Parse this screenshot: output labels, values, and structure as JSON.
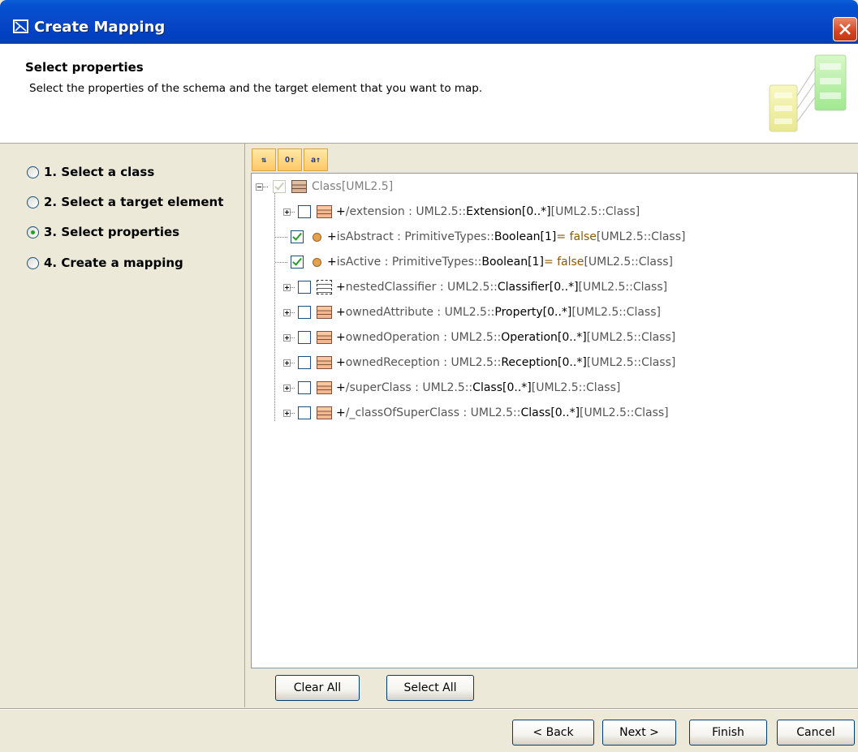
{
  "window": {
    "title": "Create Mapping",
    "close_icon": "close-icon"
  },
  "header": {
    "title": "Select properties",
    "description": "Select the properties of the schema and the target element that you want to map."
  },
  "steps": [
    {
      "label": "1. Select a class",
      "selected": false
    },
    {
      "label": "2. Select a target element",
      "selected": false
    },
    {
      "label": "3. Select properties",
      "selected": true
    },
    {
      "label": "4. Create a mapping",
      "selected": false
    }
  ],
  "toolbar": [
    {
      "icon": "sort-icon",
      "glyph": "⇅"
    },
    {
      "icon": "show-operations-icon",
      "glyph": "O↑"
    },
    {
      "icon": "show-inherited-icon",
      "glyph": "a↑"
    }
  ],
  "tree": {
    "root": {
      "label": "Class",
      "suffix": " [UML2.5]",
      "checked": true,
      "disabled": true
    },
    "items": [
      {
        "name": "/extension",
        "type_prefix": "UML2.5::",
        "type_name": "Extension",
        "mult": " [0..*]",
        "default": "",
        "owner": " [UML2.5::Class]",
        "checked": false,
        "icon": "class-icon",
        "expandable": true
      },
      {
        "name": "isAbstract",
        "type_prefix": "PrimitiveTypes::",
        "type_name": "Boolean",
        "mult": " [1]",
        "default": " = false",
        "owner": " [UML2.5::Class]",
        "checked": true,
        "icon": "property-dot-icon",
        "expandable": false
      },
      {
        "name": "isActive",
        "type_prefix": "PrimitiveTypes::",
        "type_name": "Boolean",
        "mult": " [1]",
        "default": " = false",
        "owner": " [UML2.5::Class]",
        "checked": true,
        "icon": "property-dot-icon",
        "expandable": false
      },
      {
        "name": "nestedClassifier",
        "type_prefix": "UML2.5::",
        "type_name": "Classifier",
        "mult": " [0..*]",
        "default": "",
        "owner": " [UML2.5::Class]",
        "checked": false,
        "icon": "classifier-icon",
        "expandable": true
      },
      {
        "name": "ownedAttribute",
        "type_prefix": "UML2.5::",
        "type_name": "Property",
        "mult": " [0..*]",
        "default": "",
        "owner": " [UML2.5::Class]",
        "checked": false,
        "icon": "class-icon",
        "expandable": true
      },
      {
        "name": "ownedOperation",
        "type_prefix": "UML2.5::",
        "type_name": "Operation",
        "mult": " [0..*]",
        "default": "",
        "owner": " [UML2.5::Class]",
        "checked": false,
        "icon": "class-icon",
        "expandable": true
      },
      {
        "name": "ownedReception",
        "type_prefix": "UML2.5::",
        "type_name": "Reception",
        "mult": " [0..*]",
        "default": "",
        "owner": " [UML2.5::Class]",
        "checked": false,
        "icon": "class-icon",
        "expandable": true
      },
      {
        "name": "/superClass",
        "type_prefix": "UML2.5::",
        "type_name": "Class",
        "mult": " [0..*]",
        "default": "",
        "owner": " [UML2.5::Class]",
        "checked": false,
        "icon": "class-icon",
        "expandable": true
      },
      {
        "name": "/_classOfSuperClass",
        "type_prefix": "UML2.5::",
        "type_name": "Class",
        "mult": " [0..*]",
        "default": "",
        "owner": " [UML2.5::Class]",
        "checked": false,
        "icon": "class-icon",
        "expandable": true
      }
    ],
    "clear_all": "Clear All",
    "select_all": "Select All"
  },
  "footer": {
    "back": "< Back",
    "next": "Next >",
    "finish": "Finish",
    "cancel": "Cancel"
  }
}
